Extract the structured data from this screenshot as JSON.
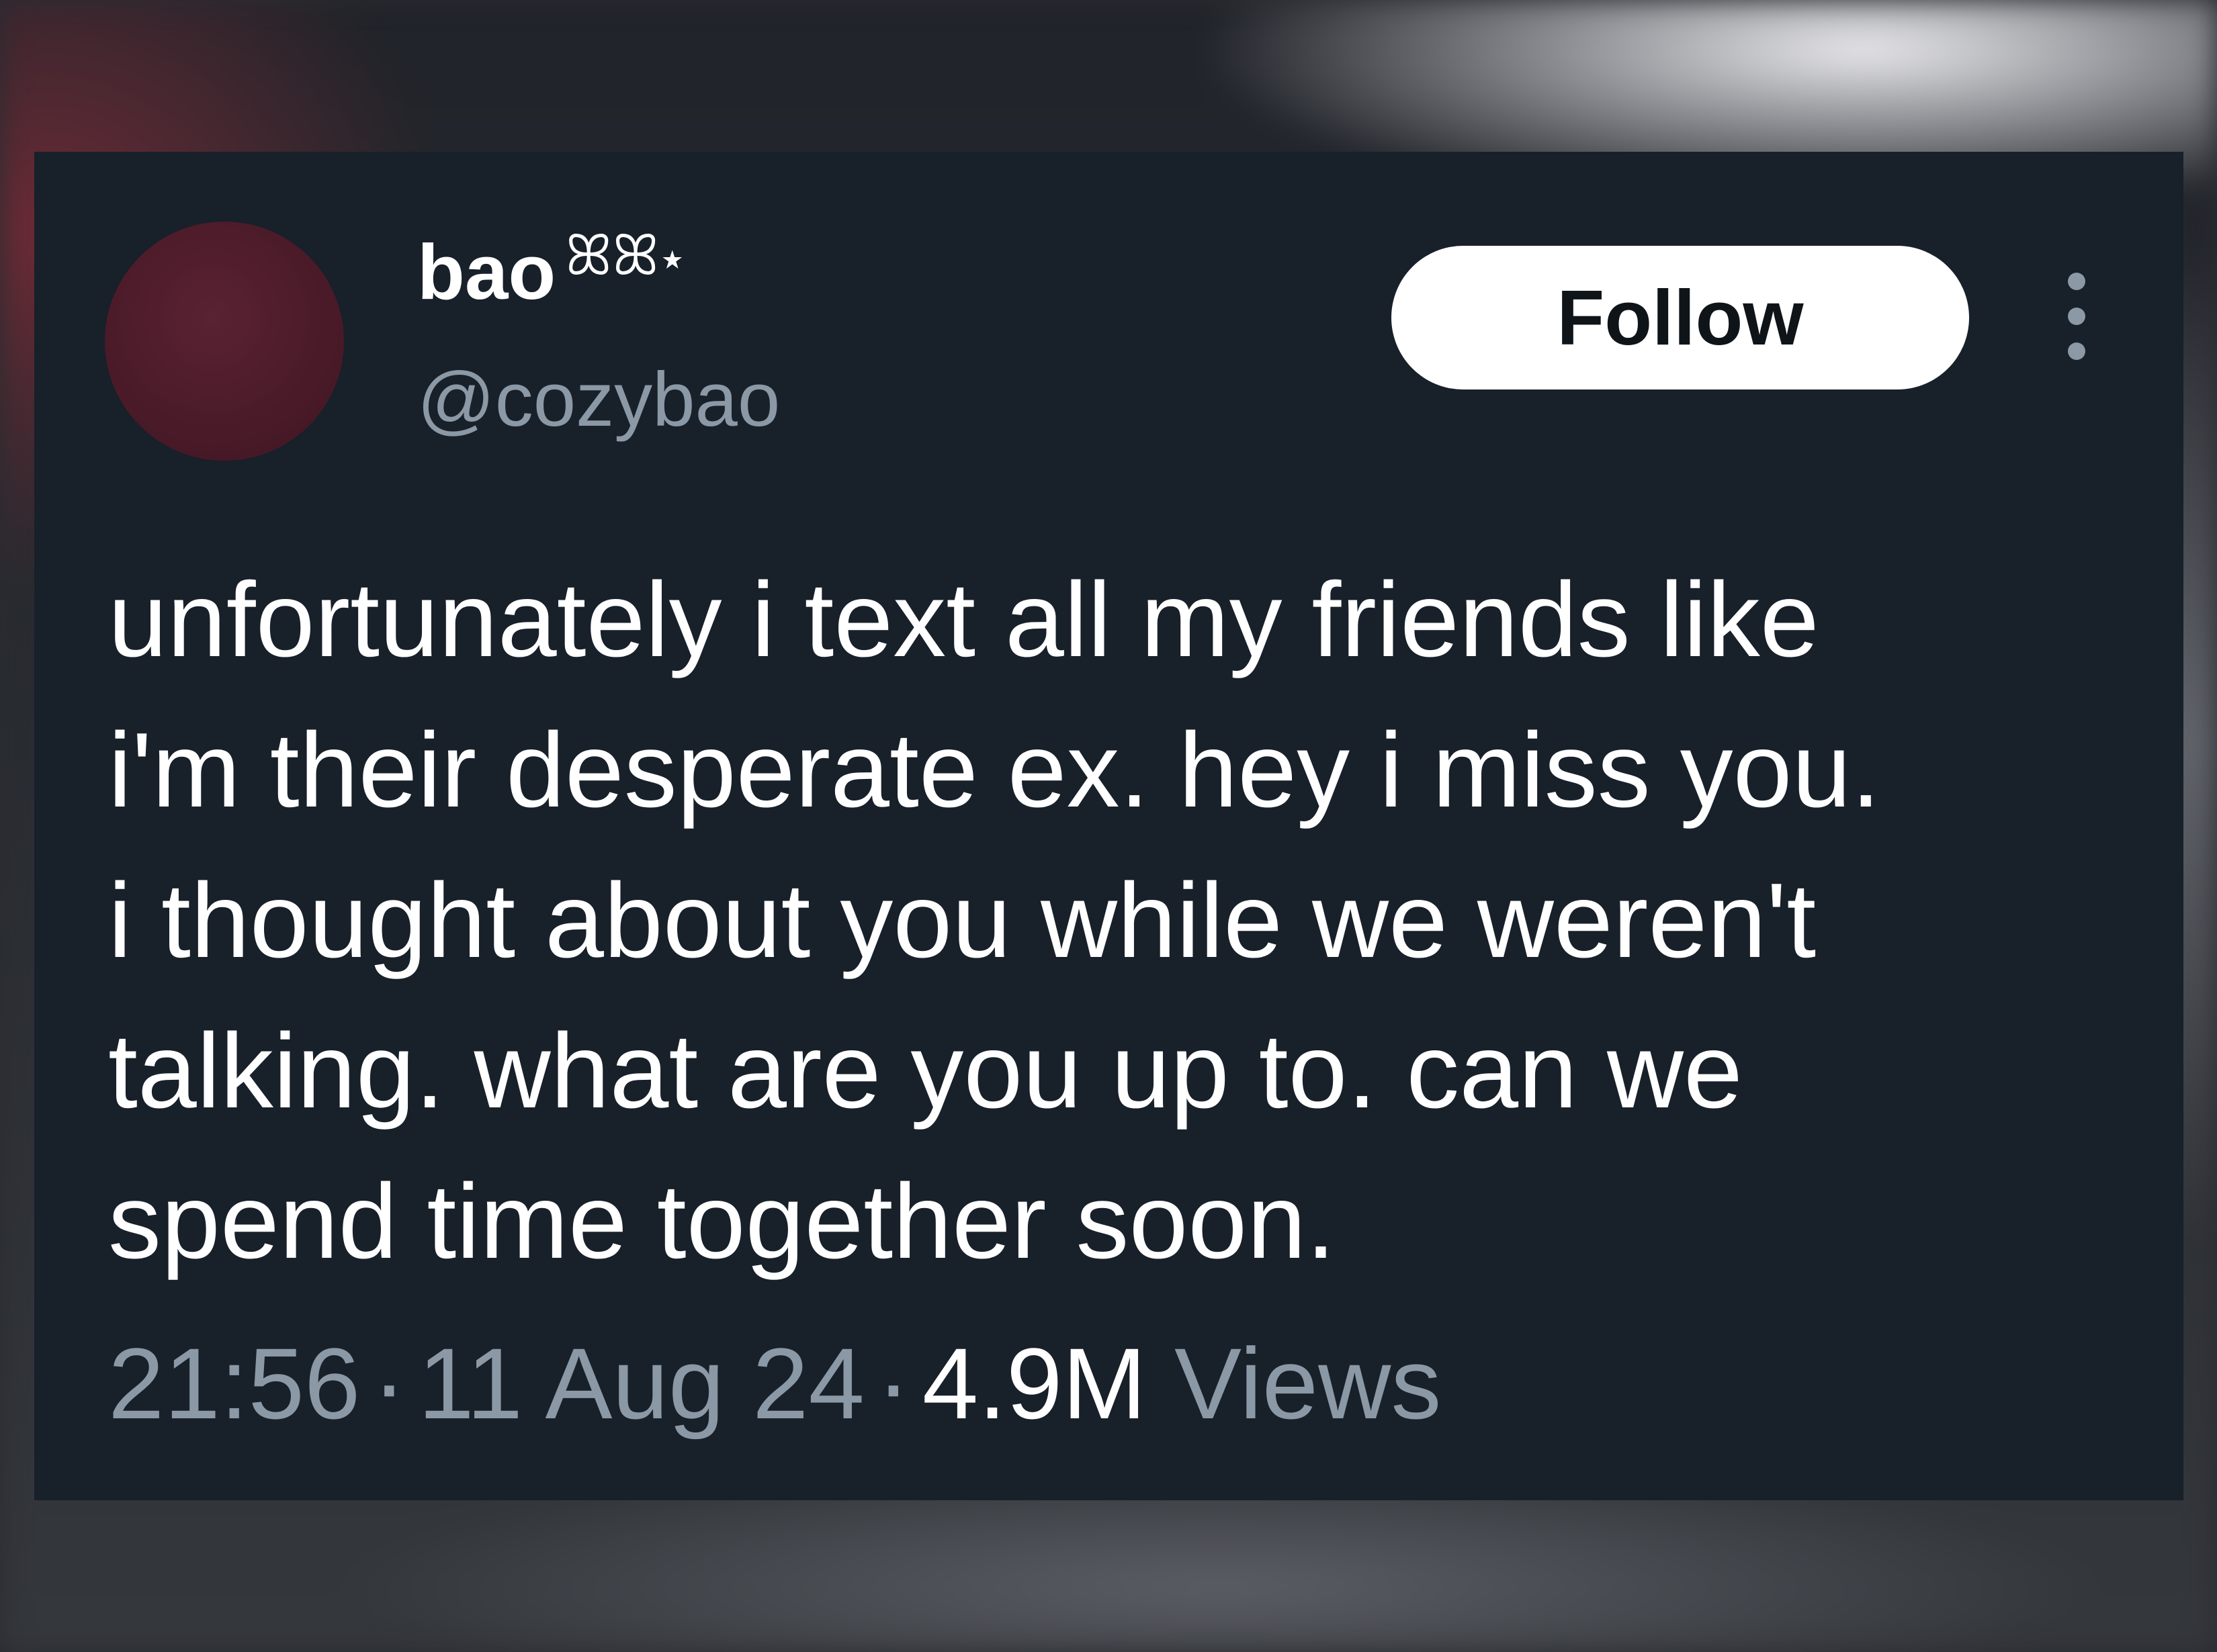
{
  "tweet": {
    "author": {
      "display_name": "bao",
      "name_decoration": "ꕤꕤ⋆",
      "handle": "@cozybao"
    },
    "follow_label": "Follow",
    "text_lines": [
      "unfortunately i text all my friends like",
      "i'm their desperate ex. hey i miss you.",
      "i thought about you while we weren't",
      "talking. what are you up to. can we",
      "spend time together soon."
    ],
    "meta": {
      "time": "21:56",
      "separator": "·",
      "date": "11 Aug 24",
      "views_count": "4.9M",
      "views_label": "Views"
    }
  },
  "icons": {
    "more": "more-vertical-icon"
  },
  "colors": {
    "card_background": "#18202a",
    "primary_text": "#ffffff",
    "secondary_text": "#8b98a5",
    "follow_button_bg": "#ffffff",
    "avatar": "#4a1a28"
  }
}
